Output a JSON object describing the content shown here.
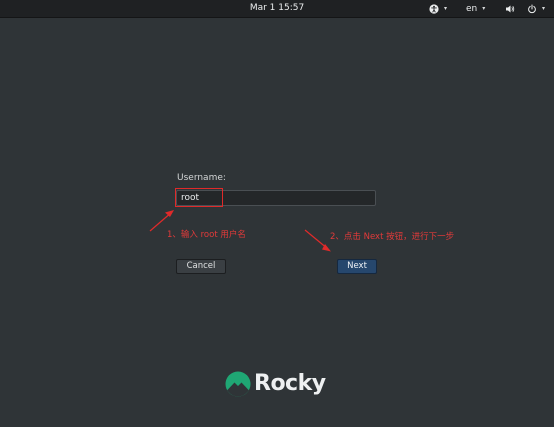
{
  "topbar": {
    "clock": "Mar 1  15:57",
    "accessibility_icon": "accessibility-icon",
    "language": "en",
    "sound_icon": "volume-icon",
    "power_icon": "power-icon",
    "caret": "▾"
  },
  "login": {
    "username_label": "Username:",
    "username_value": "root",
    "cancel_label": "Cancel",
    "next_label": "Next"
  },
  "annotations": {
    "step1": "1、输入 root 用户名",
    "step2": "2、点击 Next 按钮，进行下一步",
    "color": "#e02a2a"
  },
  "branding": {
    "logo_text": "Rocky",
    "logo_color": "#1fa774"
  },
  "colors": {
    "background": "#2f3437",
    "topbar": "#1f2123",
    "next_button": "#26476d"
  }
}
